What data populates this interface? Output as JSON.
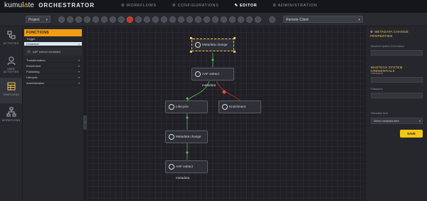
{
  "brand": {
    "name_pre": "kumul",
    "name_accent": "a",
    "name_post": "te",
    "app": "ORCHESTRATOR"
  },
  "nav": [
    {
      "label": "WORKFLOWS",
      "active": false
    },
    {
      "label": "CONFIGURATIONS",
      "active": false
    },
    {
      "label": "EDITOR",
      "active": true
    },
    {
      "label": "ADMINISTRATION",
      "active": false
    }
  ],
  "toolbar": {
    "project_select": "Project",
    "client_select": "Remote Client"
  },
  "sidebar": {
    "items": [
      {
        "label": "ACTIVITIES"
      },
      {
        "label": "USER ACTIVITIES"
      },
      {
        "label": "TEMPLATES"
      },
      {
        "label": "WORKFLOWS"
      }
    ]
  },
  "panel": {
    "header": "FUNCTIONS",
    "categories": [
      {
        "label": "Trigger"
      },
      {
        "label": "Extraction"
      },
      {
        "label": "Transformation"
      },
      {
        "label": "Enrichment"
      },
      {
        "label": "Publishing"
      },
      {
        "label": "Lifecycle"
      },
      {
        "label": "Administration"
      }
    ],
    "sub_item": "AAF extract metadata"
  },
  "nodes": [
    {
      "label": "Metadata change"
    },
    {
      "label": "AAF extract metadata"
    },
    {
      "label": "Lifecycle"
    },
    {
      "label": "Enrichment"
    },
    {
      "label": "Metadata change"
    },
    {
      "label": "AAF extract metadata"
    }
  ],
  "right_panel": {
    "header": "METADATA CHANGE PROPERTIES",
    "field_mastech_info": "Mastech system information",
    "section": "MASTECH SYSTEM CREDENTIALS",
    "field_username": "Username",
    "field_password": "Password",
    "field_metadata": "Metadata field",
    "select_placeholder": "Select metadata field",
    "save_label": "SAVE"
  },
  "colors": {
    "accent": "#f39c12",
    "save": "#f5c518",
    "success_wire": "#5fbf5f",
    "error_wire": "#c0392b"
  }
}
